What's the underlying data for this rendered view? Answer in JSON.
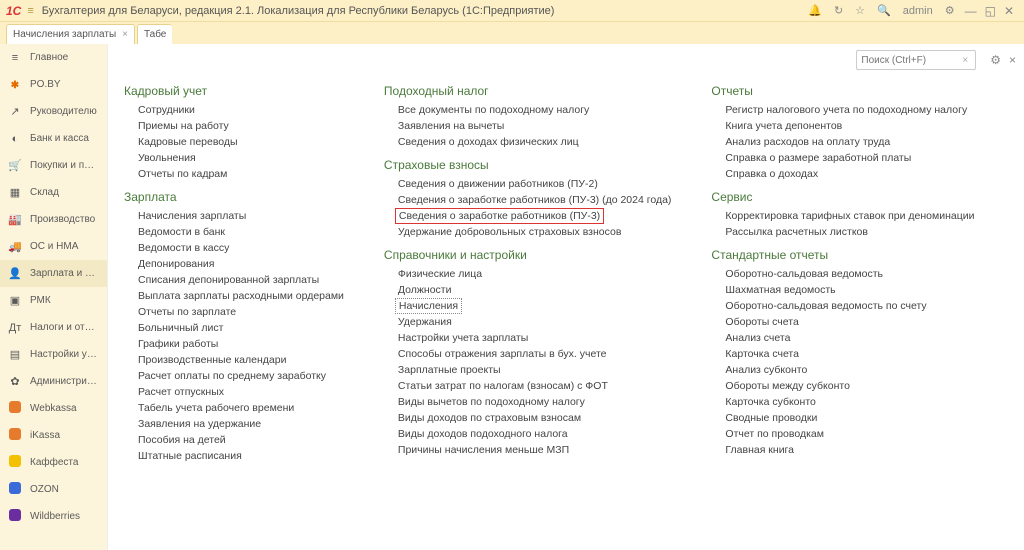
{
  "titlebar": {
    "logo": "1C",
    "title": "Бухгалтерия для Беларуси, редакция 2.1. Локализация для Республики Беларусь   (1С:Предприятие)",
    "user": "admin"
  },
  "tabs": [
    {
      "label": "Начисления зарплаты"
    },
    {
      "label": "Табе"
    }
  ],
  "search_placeholder": "Поиск (Ctrl+F)",
  "sidebar": [
    {
      "icon": "≡",
      "label": "Главное"
    },
    {
      "icon": "PO",
      "label": "PO.BY",
      "kind": "pobv"
    },
    {
      "icon": "↗",
      "label": "Руководителю"
    },
    {
      "icon": "◐",
      "label": "Банк и касса"
    },
    {
      "icon": "🛒",
      "label": "Покупки и продажи"
    },
    {
      "icon": "▦",
      "label": "Склад"
    },
    {
      "icon": "🏭",
      "label": "Производство"
    },
    {
      "icon": "🚚",
      "label": "ОС и НМА"
    },
    {
      "icon": "👤",
      "label": "Зарплата и кадры",
      "active": true
    },
    {
      "icon": "▣",
      "label": "РМК"
    },
    {
      "icon": "Дт",
      "label": "Налоги и отчетность"
    },
    {
      "icon": "▤",
      "label": "Настройки учета"
    },
    {
      "icon": "✿",
      "label": "Администрирование"
    },
    {
      "icon": "W",
      "label": "Webkassa",
      "kind": "sq-orange"
    },
    {
      "icon": "i",
      "label": "iKassa",
      "kind": "sq-orange"
    },
    {
      "icon": "●",
      "label": "Каффеста",
      "kind": "sq-yellow"
    },
    {
      "icon": "O",
      "label": "OZON",
      "kind": "sq-blue"
    },
    {
      "icon": "W",
      "label": "Wildberries",
      "kind": "sq-purple"
    }
  ],
  "columns": [
    {
      "sections": [
        {
          "heading": "Кадровый учет",
          "links": [
            "Сотрудники",
            "Приемы на работу",
            "Кадровые переводы",
            "Увольнения",
            "Отчеты по кадрам"
          ]
        },
        {
          "heading": "Зарплата",
          "links": [
            "Начисления зарплаты",
            "Ведомости в банк",
            "Ведомости в кассу",
            "Депонирования",
            "Списания депонированной зарплаты",
            "Выплата зарплаты расходными ордерами",
            "Отчеты по зарплате",
            "Больничный лист",
            "Графики работы",
            "Производственные календари",
            "Расчет оплаты по среднему заработку",
            "Расчет отпускных",
            "Табель учета рабочего времени",
            "Заявления на удержание",
            "Пособия на детей",
            "Штатные расписания"
          ]
        }
      ]
    },
    {
      "sections": [
        {
          "heading": "Подоходный налог",
          "links": [
            "Все документы по подоходному налогу",
            "Заявления на вычеты",
            "Сведения о доходах физических лиц"
          ]
        },
        {
          "heading": "Страховые взносы",
          "links": [
            "Сведения о движении работников (ПУ-2)",
            "Сведения о заработке работников (ПУ-3) (до 2024 года)",
            {
              "text": "Сведения о заработке работников (ПУ-3)",
              "redbox": true
            },
            "Удержание добровольных страховых взносов"
          ]
        },
        {
          "heading": "Справочники и настройки",
          "links": [
            "Физические лица",
            "Должности",
            {
              "text": "Начисления",
              "boxed": true
            },
            "Удержания",
            "Настройки учета зарплаты",
            "Способы отражения зарплаты в бух. учете",
            "Зарплатные проекты",
            "Статьи затрат по налогам (взносам) с ФОТ",
            "Виды вычетов по подоходному налогу",
            "Виды доходов по страховым взносам",
            "Виды доходов подоходного налога",
            "Причины начисления меньше МЗП"
          ]
        }
      ]
    },
    {
      "sections": [
        {
          "heading": "Отчеты",
          "links": [
            "Регистр налогового учета по подоходному налогу",
            "Книга учета депонентов",
            "Анализ расходов на оплату труда",
            "Справка о размере заработной платы",
            "Справка о доходах"
          ]
        },
        {
          "heading": "Сервис",
          "links": [
            "Корректировка тарифных ставок при деноминации",
            "Рассылка расчетных листков"
          ]
        },
        {
          "heading": "Стандартные отчеты",
          "links": [
            "Оборотно-сальдовая ведомость",
            "Шахматная ведомость",
            "Оборотно-сальдовая ведомость по счету",
            "Обороты счета",
            "Анализ счета",
            "Карточка счета",
            "Анализ субконто",
            "Обороты между субконто",
            "Карточка субконто",
            "Сводные проводки",
            "Отчет по проводкам",
            "Главная книга"
          ]
        }
      ]
    }
  ]
}
